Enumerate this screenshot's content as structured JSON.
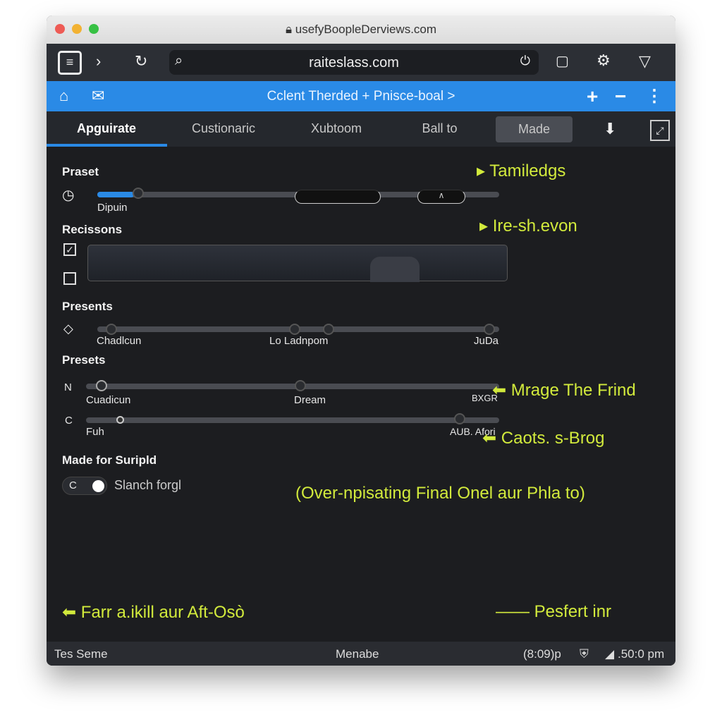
{
  "window": {
    "title": "usefyBoopleDerviews.com"
  },
  "toolbar": {
    "url": "raiteslass.com",
    "icons": [
      "sidebar-icon",
      "forward-icon",
      "reload-icon",
      "search-icon",
      "power-icon",
      "lock-icon",
      "gear-icon",
      "dropdown-triangle-icon"
    ]
  },
  "bluebar": {
    "title": "Cclent Therded + Pnisce-boal >",
    "icons": [
      "home-icon",
      "mail-icon",
      "plus-icon",
      "minus-icon",
      "more-icon"
    ]
  },
  "tabs": [
    {
      "label": "Apguirate",
      "active": true
    },
    {
      "label": "Custionaric"
    },
    {
      "label": "Xubtoom"
    },
    {
      "label": "Ball to"
    },
    {
      "label": "Made",
      "highlighted": true
    }
  ],
  "sections": {
    "preset": {
      "title": "Praset",
      "slider_label": "Dipuin",
      "value": 0.12
    },
    "recissons": {
      "title": "Recissons",
      "checkbox1": true,
      "checkbox2": false
    },
    "presents": {
      "title": "Presents",
      "labels": [
        "Chadlcun",
        "Lo Ladnpom",
        "JuDa"
      ]
    },
    "presets": {
      "title": "Presets",
      "row1": {
        "prefix": "N",
        "labels": [
          "Cuadicun",
          "Dream",
          "BXGR"
        ]
      },
      "row2": {
        "prefix": "C",
        "labels": [
          "Fuh",
          "AUB. Afori"
        ]
      }
    },
    "made": {
      "title": "Made for Suripld",
      "toggle_prefix": "C",
      "toggle_label": "Slanch forgl",
      "toggle_on": true
    }
  },
  "annotations": {
    "a1": "Tamiledgs",
    "a2": "Ire-sh.evon",
    "a3": "Mrage The Frind",
    "a4": "Caots. s-Brog",
    "a5": "(Over-npisating Final Onel aur Phla to)",
    "a6": "Farr a.ikill aur Aft-Osò",
    "a7": "Pesfert inr",
    "color": "#d2ea3c"
  },
  "status": {
    "left": "Tes Seme",
    "center": "Menabe",
    "time1": "(8:09)p",
    "time2": ".50:0 pm"
  },
  "colors": {
    "accent": "#2a8ae6"
  }
}
